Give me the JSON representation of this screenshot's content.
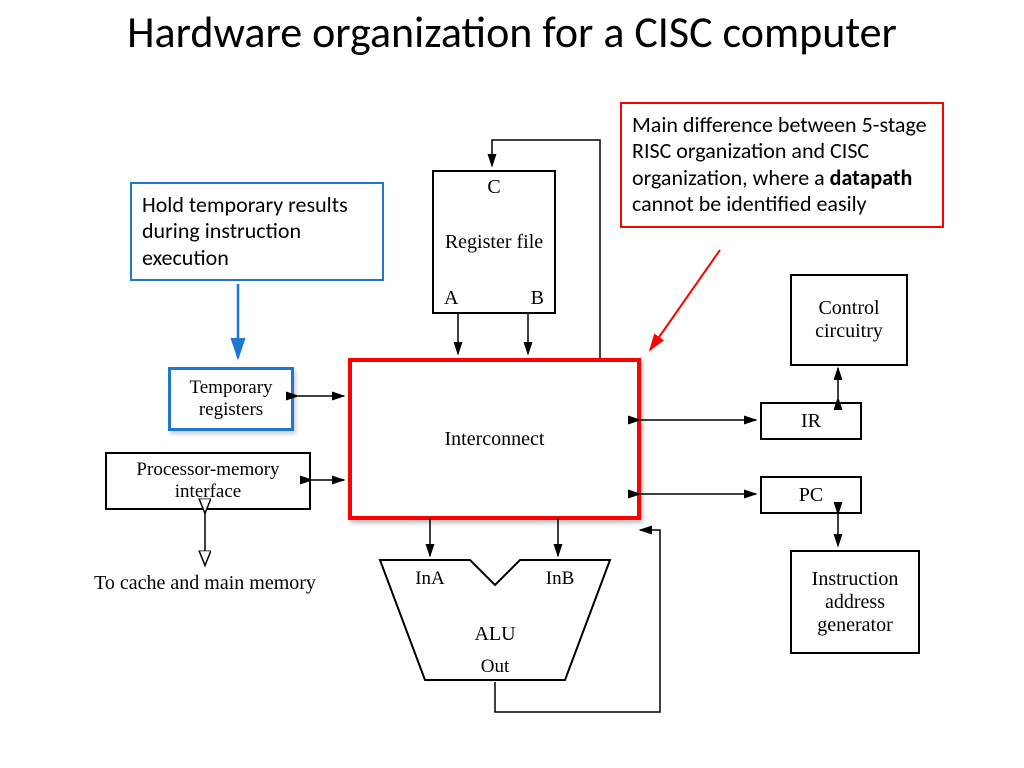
{
  "title": "Hardware organization for a CISC computer",
  "callout_blue": "Hold temporary results during instruction execution",
  "callout_red_part1": "Main difference between 5-stage RISC organization and CISC organization, where a ",
  "callout_red_bold": "datapath",
  "callout_red_part2": " cannot be identified easily",
  "blocks": {
    "register_file": "Register file",
    "reg_port_c": "C",
    "reg_port_a": "A",
    "reg_port_b": "B",
    "temporary_registers": "Temporary registers",
    "processor_memory_interface": "Processor-memory interface",
    "interconnect": "Interconnect",
    "control_circuitry": "Control circuitry",
    "ir": "IR",
    "pc": "PC",
    "instruction_address_generator": "Instruction address generator",
    "alu": "ALU",
    "alu_inA": "InA",
    "alu_inB": "InB",
    "alu_out": "Out",
    "to_cache": "To cache and main memory"
  }
}
